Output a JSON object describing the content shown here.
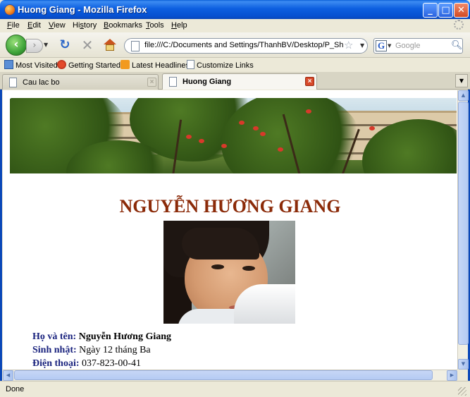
{
  "window": {
    "title": "Huong Giang - Mozilla Firefox"
  },
  "menu": {
    "items": [
      {
        "label": "File",
        "accel": "F"
      },
      {
        "label": "Edit",
        "accel": "E"
      },
      {
        "label": "View",
        "accel": "V"
      },
      {
        "label": "History",
        "accel": "s"
      },
      {
        "label": "Bookmarks",
        "accel": "B"
      },
      {
        "label": "Tools",
        "accel": "T"
      },
      {
        "label": "Help",
        "accel": "H"
      }
    ]
  },
  "navigation": {
    "url": "file:///C:/Documents and Settings/ThanhBV/Desktop/P_Share/Hu",
    "search_placeholder": "Google"
  },
  "bookmarks": {
    "items": [
      {
        "label": "Most Visited",
        "icon": "most-visited-icon"
      },
      {
        "label": "Getting Started",
        "icon": "getting-started-icon"
      },
      {
        "label": "Latest Headlines",
        "icon": "rss-feed-icon"
      },
      {
        "label": "Customize Links",
        "icon": "page-icon"
      }
    ]
  },
  "tabs": [
    {
      "label": "Cau lac bo",
      "active": false
    },
    {
      "label": "Huong Giang",
      "active": true
    }
  ],
  "page": {
    "name_heading": "NGUYỄN HƯƠNG GIANG",
    "info": [
      {
        "label": "Họ và tên:",
        "value": "Nguyễn Hương Giang",
        "bold": true
      },
      {
        "label": "Sinh nhật:",
        "value": "Ngày 12 tháng Ba",
        "bold": false
      },
      {
        "label": "Điện thoại:",
        "value": "037-823-00-41",
        "bold": false
      }
    ]
  },
  "status": {
    "text": "Done"
  },
  "colors": {
    "heading": "#8b2a08",
    "label": "#1a237e",
    "titlebar": "#0650d0"
  }
}
